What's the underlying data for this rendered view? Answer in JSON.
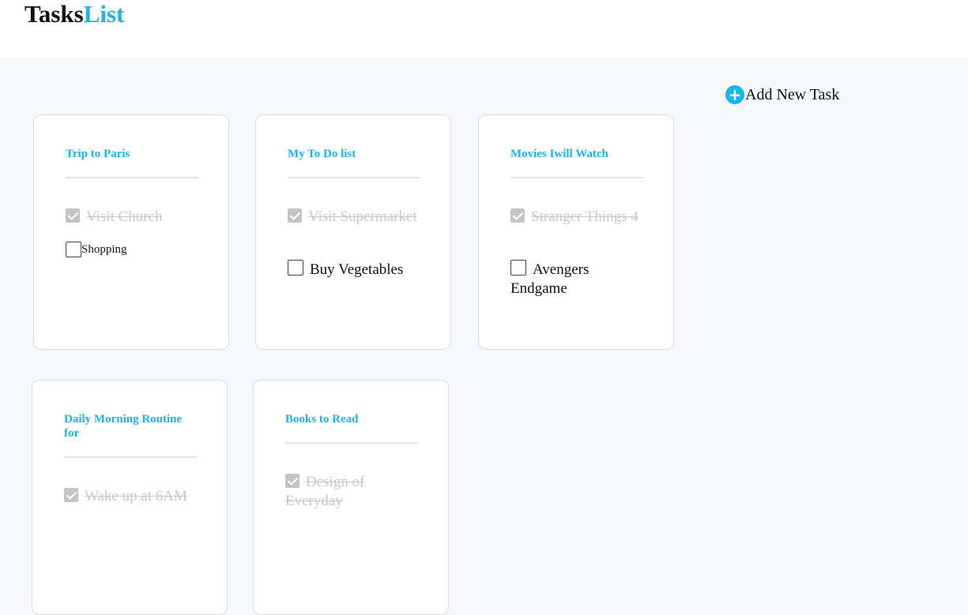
{
  "brand": {
    "part1": "Tasks",
    "part2": "List"
  },
  "add_task": {
    "label": "Add New Task",
    "icon": "plus-circle-icon"
  },
  "colors": {
    "accent": "#1ab4e8",
    "page_bg": "#f7f8fc",
    "done_text": "#c8c8c8"
  },
  "cards": [
    {
      "title": "Trip to Paris",
      "tasks": [
        {
          "text": "Visit Church",
          "done": true
        },
        {
          "text": "Shopping",
          "done": false
        }
      ]
    },
    {
      "title": "My To Do list",
      "tasks": [
        {
          "text": "Visit Supermarket",
          "done": true
        },
        {
          "text": "Buy Vegetables",
          "done": false
        }
      ]
    },
    {
      "title": "Movies Iwill Watch",
      "tasks": [
        {
          "text": "Stranger Things 4",
          "done": true
        },
        {
          "text": "Avengers Endgame",
          "done": false
        }
      ]
    },
    {
      "title": "Daily Morning Routine for",
      "tasks": [
        {
          "text": "Wake up at 6AM",
          "done": true
        }
      ]
    },
    {
      "title": "Books to Read",
      "tasks": [
        {
          "text": "Design of Everyday",
          "done": true
        }
      ]
    }
  ]
}
